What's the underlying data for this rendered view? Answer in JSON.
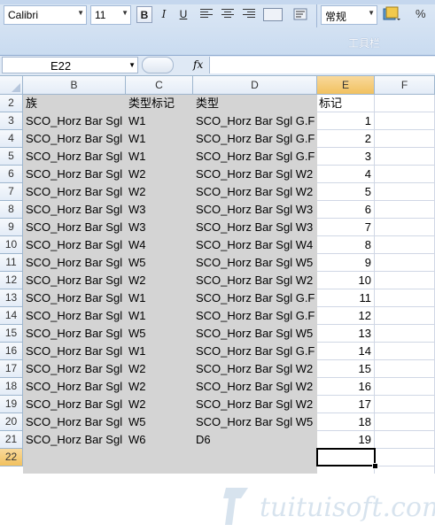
{
  "ribbon": {
    "font_name": "Calibri",
    "font_size": "11",
    "bold_label": "B",
    "italic_label": "I",
    "underline_label": "U",
    "number_format": "常规",
    "percent_label": "%",
    "group_label": "工具栏"
  },
  "formula_bar": {
    "name_box": "E22",
    "fx_label": "fx",
    "formula": ""
  },
  "columns": [
    "B",
    "C",
    "D",
    "E",
    "F"
  ],
  "rows": [
    {
      "num": "2",
      "b": "族",
      "c": "类型标记",
      "d": "类型",
      "e": "标记"
    },
    {
      "num": "3",
      "b": "SCO_Horz Bar Sgl",
      "c": "W1",
      "d": "SCO_Horz Bar Sgl G.F",
      "e": "1"
    },
    {
      "num": "4",
      "b": "SCO_Horz Bar Sgl",
      "c": "W1",
      "d": "SCO_Horz Bar Sgl G.F",
      "e": "2"
    },
    {
      "num": "5",
      "b": "SCO_Horz Bar Sgl",
      "c": "W1",
      "d": "SCO_Horz Bar Sgl G.F",
      "e": "3"
    },
    {
      "num": "6",
      "b": "SCO_Horz Bar Sgl",
      "c": "W2",
      "d": "SCO_Horz Bar Sgl W2",
      "e": "4"
    },
    {
      "num": "7",
      "b": "SCO_Horz Bar Sgl",
      "c": "W2",
      "d": "SCO_Horz Bar Sgl W2",
      "e": "5"
    },
    {
      "num": "8",
      "b": "SCO_Horz Bar Sgl",
      "c": "W3",
      "d": "SCO_Horz Bar Sgl W3",
      "e": "6"
    },
    {
      "num": "9",
      "b": "SCO_Horz Bar Sgl",
      "c": "W3",
      "d": "SCO_Horz Bar Sgl W3",
      "e": "7"
    },
    {
      "num": "10",
      "b": "SCO_Horz Bar Sgl",
      "c": "W4",
      "d": "SCO_Horz Bar Sgl W4",
      "e": "8"
    },
    {
      "num": "11",
      "b": "SCO_Horz Bar Sgl",
      "c": "W5",
      "d": "SCO_Horz Bar Sgl W5",
      "e": "9"
    },
    {
      "num": "12",
      "b": "SCO_Horz Bar Sgl",
      "c": "W2",
      "d": "SCO_Horz Bar Sgl W2",
      "e": "10"
    },
    {
      "num": "13",
      "b": "SCO_Horz Bar Sgl",
      "c": "W1",
      "d": "SCO_Horz Bar Sgl G.F",
      "e": "11"
    },
    {
      "num": "14",
      "b": "SCO_Horz Bar Sgl",
      "c": "W1",
      "d": "SCO_Horz Bar Sgl G.F",
      "e": "12"
    },
    {
      "num": "15",
      "b": "SCO_Horz Bar Sgl",
      "c": "W5",
      "d": "SCO_Horz Bar Sgl W5",
      "e": "13"
    },
    {
      "num": "16",
      "b": "SCO_Horz Bar Sgl",
      "c": "W1",
      "d": "SCO_Horz Bar Sgl G.F",
      "e": "14"
    },
    {
      "num": "17",
      "b": "SCO_Horz Bar Sgl",
      "c": "W2",
      "d": "SCO_Horz Bar Sgl W2",
      "e": "15"
    },
    {
      "num": "18",
      "b": "SCO_Horz Bar Sgl",
      "c": "W2",
      "d": "SCO_Horz Bar Sgl W2",
      "e": "16"
    },
    {
      "num": "19",
      "b": "SCO_Horz Bar Sgl",
      "c": "W2",
      "d": "SCO_Horz Bar Sgl W2",
      "e": "17"
    },
    {
      "num": "20",
      "b": "SCO_Horz Bar Sgl",
      "c": "W5",
      "d": "SCO_Horz Bar Sgl W5",
      "e": "18"
    },
    {
      "num": "21",
      "b": "SCO_Horz Bar Sgl",
      "c": "W6",
      "d": "D6",
      "e": "19"
    },
    {
      "num": "22",
      "b": "",
      "c": "",
      "d": "",
      "e": ""
    }
  ],
  "watermark": "tuituisoft.com",
  "colors": {
    "ribbon_bg": "#c9dbf0",
    "header_active": "#f1c15f",
    "selection_shade": "#d4d4d4",
    "gridline": "#d0d7e5"
  }
}
